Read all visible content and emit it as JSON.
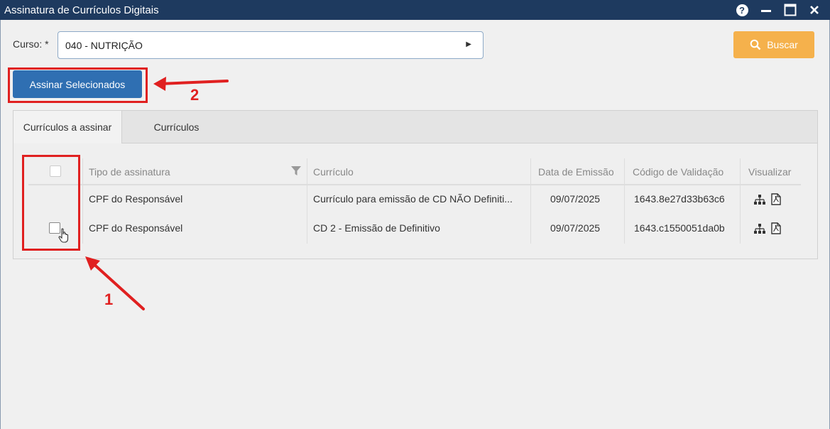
{
  "window": {
    "title": "Assinatura de Currículos Digitais"
  },
  "form": {
    "curso_label": "Curso: *",
    "curso_value": "040 - NUTRIÇÃO",
    "buscar_label": "Buscar",
    "assinar_label": "Assinar Selecionados"
  },
  "tabs": [
    {
      "label": "Currículos a assinar",
      "active": true
    },
    {
      "label": "Currículos",
      "active": false
    }
  ],
  "table": {
    "columns": [
      "Tipo de assinatura",
      "Currículo",
      "Data de Emissão",
      "Código de Validação",
      "Visualizar"
    ],
    "rows": [
      {
        "tipo": "CPF do Responsável",
        "curriculo": "Currículo para emissão de CD NÃO Definiti...",
        "data": "09/07/2025",
        "codigo": "1643.8e27d33b63c6"
      },
      {
        "tipo": "CPF do Responsável",
        "curriculo": "CD 2 - Emissão de Definitivo",
        "data": "09/07/2025",
        "codigo": "1643.c1550051da0b"
      }
    ]
  },
  "annotations": {
    "step1": "1",
    "step2": "2"
  },
  "colors": {
    "titlebar": "#1e3a5f",
    "primary": "#2f6fb2",
    "buscar": "#f5b14c",
    "annotation": "#e02020"
  }
}
